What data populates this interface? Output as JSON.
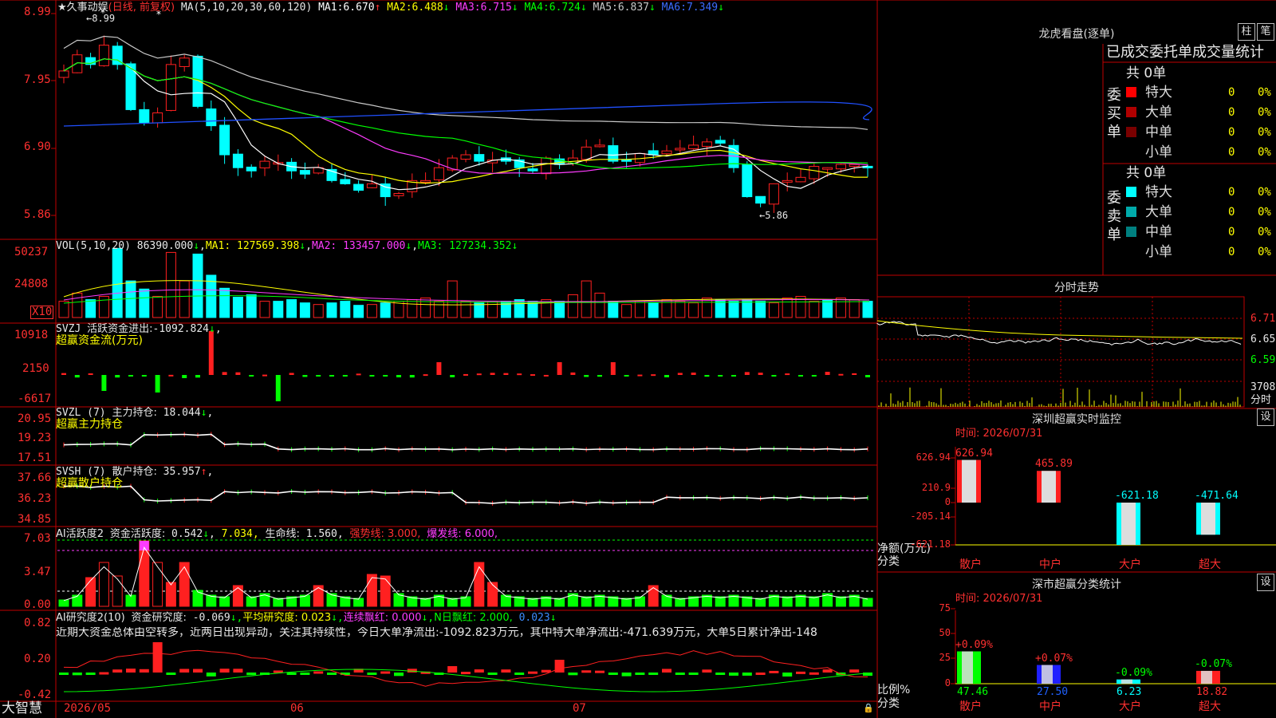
{
  "brand": "大智慧",
  "main": {
    "title": "★久事动娱",
    "mode": "(日线, 前复权)",
    "ma_label": "MA(5,10,20,30,60,120)",
    "ma": [
      {
        "label": "MA1:",
        "value": "6.670",
        "dir": "↑",
        "color": "#ffffff"
      },
      {
        "label": "MA2:",
        "value": "6.488",
        "dir": "↓",
        "color": "#ffff00"
      },
      {
        "label": "MA3:",
        "value": "6.715",
        "dir": "↓",
        "color": "#ff3cff"
      },
      {
        "label": "MA4:",
        "value": "6.724",
        "dir": "↓",
        "color": "#00ff00"
      },
      {
        "label": "MA5:",
        "value": "6.837",
        "dir": "↓",
        "color": "#c8c8c8"
      },
      {
        "label": "MA6:",
        "value": "7.349",
        "dir": "↓",
        "color": "#3c6cff"
      }
    ],
    "yticks": [
      "8.99",
      "7.95",
      "6.90",
      "5.86"
    ],
    "high_label": "←8.99",
    "low_label": "←5.86"
  },
  "vol": {
    "label": "VOL(5,10,20)",
    "value": "86390.000",
    "dir": "↓",
    "ma": [
      {
        "label": "MA1:",
        "value": "127569.398",
        "dir": "↓",
        "color": "#ffff00"
      },
      {
        "label": "MA2:",
        "value": "133457.000",
        "dir": "↓",
        "color": "#ff3cff"
      },
      {
        "label": "MA3:",
        "value": "127234.352",
        "dir": "↓",
        "color": "#00ff00"
      }
    ],
    "yticks": [
      "50237",
      "24808"
    ],
    "unit": "X10"
  },
  "svzj": {
    "label": "SVZJ",
    "sub": "活跃资金进出:",
    "value": "-1092.824",
    "dir": "↓",
    "sep": ",",
    "title": "超赢资金流(万元)",
    "yticks": [
      "10918",
      "2150",
      "-6617"
    ]
  },
  "svzl": {
    "label": "SVZL (7)",
    "sub": "主力持仓:",
    "value": "18.044",
    "dir": "↓",
    "sep": ",",
    "title": "超赢主力持仓",
    "yticks": [
      "20.95",
      "19.23",
      "17.51"
    ]
  },
  "svsh": {
    "label": "SVSH (7)",
    "sub": "散户持仓:",
    "value": "35.957",
    "dir": "↑",
    "sep": ",",
    "title": "超赢散户持仓",
    "yticks": [
      "37.66",
      "36.23",
      "34.85"
    ]
  },
  "ai1": {
    "label": "AI活跃度2",
    "sub": "资金活跃度:",
    "v1": "0.542",
    "d1": "↓",
    "v2": "7.034",
    "d2": ",",
    "life_label": "生命线:",
    "life": "1.560",
    "d3": ",",
    "strong": "强势线: 3.000,",
    "burst": "爆发线: 6.000,",
    "yticks": [
      "7.03",
      "3.47",
      "0.00"
    ]
  },
  "ai2": {
    "label": "AI研究度2(10)",
    "sub": "资金研究度:",
    "v1": "-0.069",
    "d1": "↓,",
    "avg": "平均研究度: 0.023",
    "d2": "↓,",
    "cont": "连续飘红: 0.000",
    "d3": "↓,",
    "nday": "N日飘红: 2.000,",
    "last": "0.023",
    "d4": "↓",
    "comment": "近期大资金总体由空转多，近两日出现异动，关注其持续性，今日大单净流出:-1092.823万元，其中特大单净流出:-471.639万元，大单5日累计净出-148",
    "yticks": [
      "0.82",
      "0.20",
      "-0.42"
    ]
  },
  "xaxis": [
    "2026/05",
    "06",
    "07"
  ],
  "rb": {
    "title": "龙虎看盘(逐单)",
    "btn_bar": "柱",
    "btn_pen": "笔",
    "tabs": [
      "已成交",
      "委托单",
      "成交量统计"
    ],
    "buy": {
      "side": "委买单",
      "total": "共 0单",
      "rows": [
        {
          "label": "特大",
          "count": "0",
          "pct": "0%",
          "color": "#ff0000"
        },
        {
          "label": "大单",
          "count": "0",
          "pct": "0%",
          "color": "#b00000"
        },
        {
          "label": "中单",
          "count": "0",
          "pct": "0%",
          "color": "#7a0000"
        },
        {
          "label": "小单",
          "count": "0",
          "pct": "0%",
          "color": ""
        }
      ]
    },
    "sell": {
      "side": "委卖单",
      "total": "共 0单",
      "rows": [
        {
          "label": "特大",
          "count": "0",
          "pct": "0%",
          "color": "#00ffff"
        },
        {
          "label": "大单",
          "count": "0",
          "pct": "0%",
          "color": "#00aaaa"
        },
        {
          "label": "中单",
          "count": "0",
          "pct": "0%",
          "color": "#008080"
        },
        {
          "label": "小单",
          "count": "0",
          "pct": "0%",
          "color": ""
        }
      ]
    }
  },
  "intraday": {
    "title": "分时走势",
    "prices": [
      "6.71",
      "6.65",
      "6.59"
    ],
    "vol": "3708",
    "tag": "分时"
  },
  "monitor": {
    "title": "深圳超赢实时监控",
    "btn": "设",
    "time": "时间: 2026/07/31",
    "yticks": [
      "626.94",
      "210.9",
      "0",
      "-205.14",
      "-621.18"
    ],
    "ylabel": "净额(万元)",
    "xlabel": "分类",
    "categories": [
      "散户",
      "中户",
      "大户",
      "超大"
    ],
    "values": [
      626.94,
      465.89,
      -621.18,
      -471.64
    ],
    "value_labels": [
      "626.94",
      "465.89",
      "-621.18",
      "-471.64"
    ]
  },
  "classify": {
    "title": "深市超赢分类统计",
    "btn": "设",
    "time": "时间: 2026/07/31",
    "yticks": [
      "75",
      "50",
      "25",
      "0"
    ],
    "ylabel": "比例%",
    "xlabel": "分类",
    "categories": [
      "散户",
      "中户",
      "大户",
      "超大"
    ],
    "values": [
      47.46,
      27.5,
      6.23,
      18.82
    ],
    "value_labels": [
      "47.46",
      "27.50",
      "6.23",
      "18.82"
    ],
    "deltas": [
      "+0.09%",
      "+0.07%",
      "-0.09%",
      "-0.07%"
    ],
    "colors": [
      "#00ff00",
      "#2020ff",
      "#00ffff",
      "#ff2020"
    ]
  }
}
